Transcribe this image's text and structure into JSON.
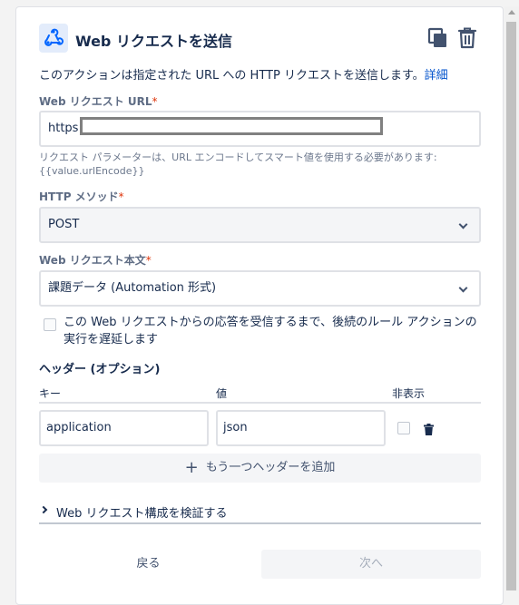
{
  "header": {
    "title": "Web リクエストを送信",
    "icons": [
      "webhook-icon",
      "copy-icon",
      "trash-icon"
    ]
  },
  "description": {
    "text": "このアクションは指定された URL への HTTP リクエストを送信します。",
    "link": "詳細"
  },
  "url_field": {
    "label": "Web リクエスト URL",
    "required_mark": "*",
    "value": "https:"
  },
  "helper": {
    "line1": "リクエスト パラメーターは、URL エンコードしてスマート値を使用する必要があります:",
    "line2": "{{value.urlEncode}}"
  },
  "method_field": {
    "label": "HTTP メソッド",
    "required_mark": "*",
    "value": "POST"
  },
  "body_field": {
    "label": "Web リクエスト本文",
    "required_mark": "*",
    "value": "課題データ (Automation 形式)"
  },
  "wait_checkbox": {
    "label": "この Web リクエストからの応答を受信するまで、後続のルール アクションの実行を遅延します",
    "checked": false
  },
  "headers_section": {
    "title": "ヘッダー (オプション)",
    "columns": [
      "キー",
      "値",
      "非表示"
    ],
    "rows": [
      {
        "key": "application",
        "value": "json",
        "hidden": false
      }
    ],
    "add_label": "もう一つヘッダーを追加"
  },
  "validate": {
    "label": "Web リクエスト構成を検証する"
  },
  "footer": {
    "back_label": "戻る",
    "next_label": "次へ"
  },
  "colors": {
    "link": "#0052cc",
    "required": "#de350b",
    "icon_blue": "#0065ff",
    "text": "#172b4d"
  }
}
